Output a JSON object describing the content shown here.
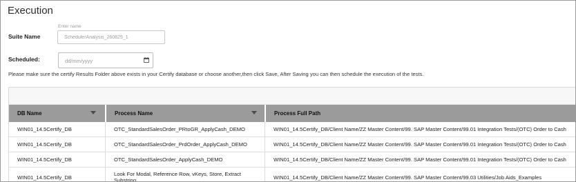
{
  "page": {
    "title": "Execution"
  },
  "form": {
    "suite_name_label": "Suite Name",
    "suite_name_floating_label": "Enter name",
    "suite_name_value": "SchedulerAnalysis_260825_1",
    "scheduled_label": "Scheduled:",
    "scheduled_placeholder": "dd/mm/yyyy",
    "calendar_icon": "calendar-icon"
  },
  "info_text": "Please make sure the certify Results Folder above exists in your Certify database or choose another,then click Save, After Saving you can then schedule the execution of the tests.",
  "table": {
    "columns": [
      {
        "label": "DB Name",
        "sortable": true
      },
      {
        "label": "Process Name",
        "sortable": true
      },
      {
        "label": "Process Full Path",
        "sortable": false
      }
    ],
    "rows": [
      {
        "db_name": "WIN01_14.5Certify_DB",
        "process_name": "OTC_StandardSalesOrder_PRtoGR_ApplyCash_DEMO",
        "full_path": "WIN01_14.5Certify_DB/Client Name/ZZ Master Content/99. SAP Master Content/99.01 Integration Tests/(OTC) Order to Cash"
      },
      {
        "db_name": "WIN01_14.5Certify_DB",
        "process_name": "OTC_StandardSalesOrder_PrdOrder_ApplyCash_DEMO",
        "full_path": "WIN01_14.5Certify_DB/Client Name/ZZ Master Content/99. SAP Master Content/99.01 Integration Tests/(OTC) Order to Cash"
      },
      {
        "db_name": "WIN01_14.5Certify_DB",
        "process_name": "OTC_StandardSalesOrder_ApplyCash_DEMO",
        "full_path": "WIN01_14.5Certify_DB/Client Name/ZZ Master Content/99. SAP Master Content/99.01 Integration Tests/(OTC) Order to Cash"
      },
      {
        "db_name": "WIN01_14.5Certify_DB",
        "process_name": "Look For Modal, Reference Row, vKeys, Store, Extract Substring",
        "full_path": "WIN01_14.5Certify_DB/Client Name/ZZ Master Content/99. SAP Master Content/99.03 Utilities/Job Aids_Examples"
      }
    ]
  }
}
